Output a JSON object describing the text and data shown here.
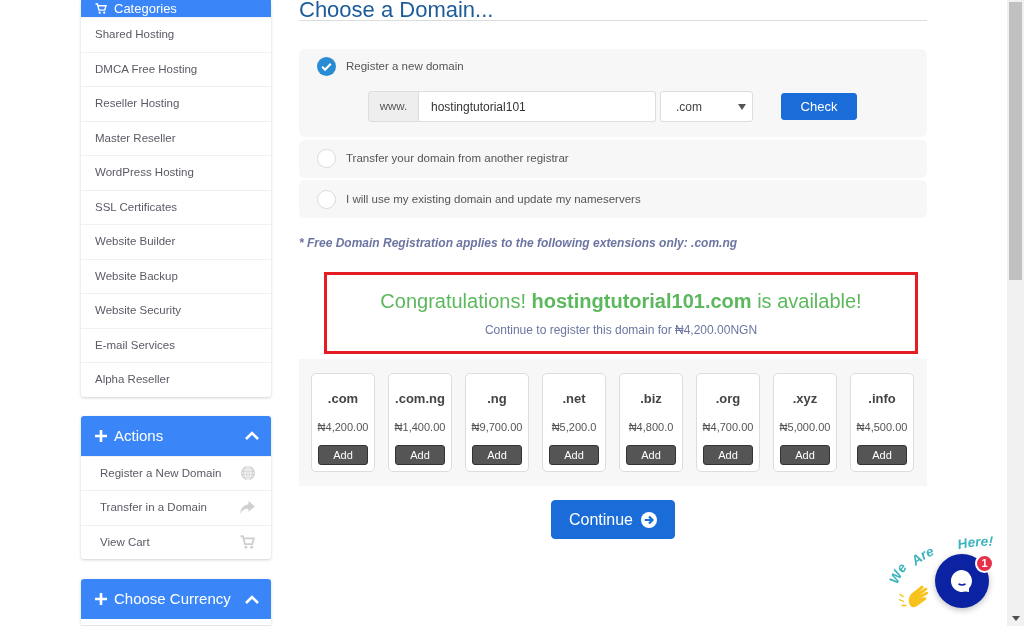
{
  "sidebar": {
    "categories": {
      "title": "Categories",
      "items": [
        "Shared Hosting",
        "DMCA Free Hosting",
        "Reseller Hosting",
        "Master Reseller",
        "WordPress Hosting",
        "SSL Certificates",
        "Website Builder",
        "Website Backup",
        "Website Security",
        "E-mail Services",
        "Alpha Reseller"
      ]
    },
    "actions": {
      "title": "Actions",
      "expanded": true,
      "items": [
        {
          "label": "Register a New Domain",
          "kind": "globe"
        },
        {
          "label": "Transfer in a Domain",
          "kind": "share"
        },
        {
          "label": "View Cart",
          "kind": "cart"
        }
      ]
    },
    "currency": {
      "title": "Choose Currency",
      "expanded": true
    }
  },
  "page_title": "Choose a Domain...",
  "domain_options": [
    {
      "label": "Register a new domain",
      "selected": true
    },
    {
      "label": "Transfer your domain from another registrar",
      "selected": false
    },
    {
      "label": "I will use my existing domain and update my nameservers",
      "selected": false
    }
  ],
  "domain_search": {
    "prefix": "www.",
    "value": "hostingtutorial101",
    "tld": ".com",
    "button": "Check"
  },
  "free_note": "* Free Domain Registration applies to the following extensions only: .com.ng",
  "availability": {
    "headline": "Congratulations! **hostingtutorial101.com** is available!",
    "subline": "Continue to register this domain for ₦4,200.00NGN"
  },
  "extensions": [
    {
      "tld": ".com",
      "price": "₦4,200.00",
      "button": "Add"
    },
    {
      "tld": ".com.ng",
      "price": "₦1,400.00",
      "button": "Add"
    },
    {
      "tld": ".ng",
      "price": "₦9,700.00",
      "button": "Add"
    },
    {
      "tld": ".net",
      "price": "₦5,200.0",
      "button": "Add"
    },
    {
      "tld": ".biz",
      "price": "₦4,800.0",
      "button": "Add"
    },
    {
      "tld": ".org",
      "price": "₦4,700.00",
      "button": "Add"
    },
    {
      "tld": ".xyz",
      "price": "₦5,000.00",
      "button": "Add"
    },
    {
      "tld": ".info",
      "price": "₦4,500.00",
      "button": "Add"
    }
  ],
  "continue_button": "Continue",
  "chat_widget": {
    "caption": [
      "We",
      "Are",
      "Here!"
    ],
    "badge": "1"
  }
}
